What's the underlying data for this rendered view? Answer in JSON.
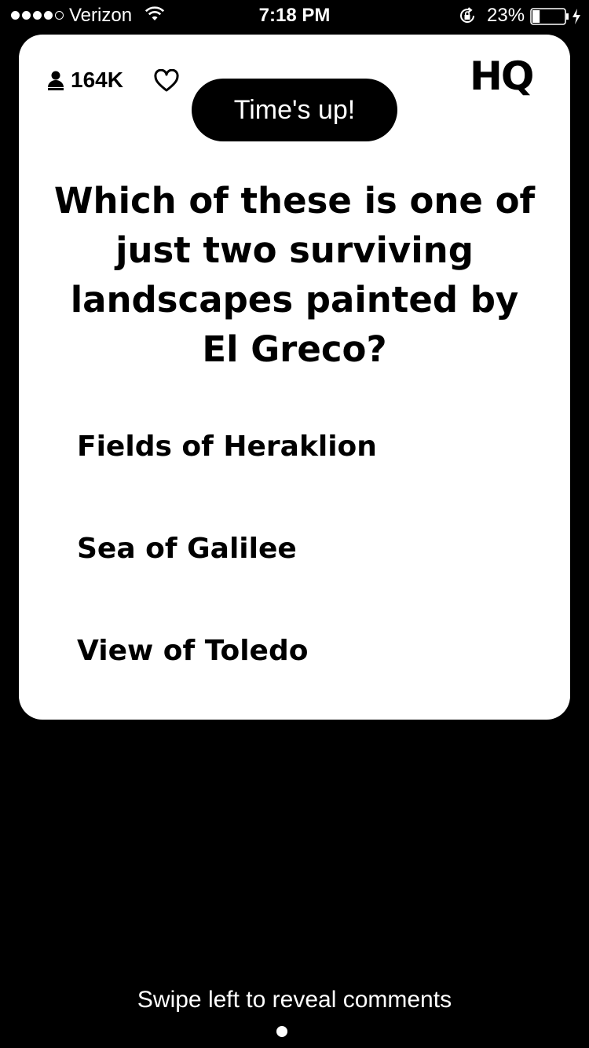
{
  "status_bar": {
    "signal_filled": 4,
    "signal_total": 5,
    "carrier": "Verizon",
    "time": "7:18 PM",
    "battery_percent": "23%",
    "battery_level": 0.23
  },
  "card": {
    "viewers_count": "164K",
    "logo": "HQ",
    "timer_badge": "Time's up!",
    "question": "Which of these is one of just two surviving landscapes painted by El Greco?",
    "answers": [
      {
        "label": "Fields of Heraklion"
      },
      {
        "label": "Sea of Galilee"
      },
      {
        "label": "View of Toledo"
      }
    ]
  },
  "footer": {
    "swipe_hint": "Swipe left to reveal comments"
  },
  "colors": {
    "background": "#000000",
    "card": "#ffffff",
    "text_dark": "#000000",
    "text_light": "#ffffff"
  },
  "icons": {
    "wifi": "wifi-icon",
    "orientation_lock": "orientation-lock-icon",
    "battery": "battery-icon",
    "viewers": "person-icon",
    "heart": "heart-icon"
  }
}
